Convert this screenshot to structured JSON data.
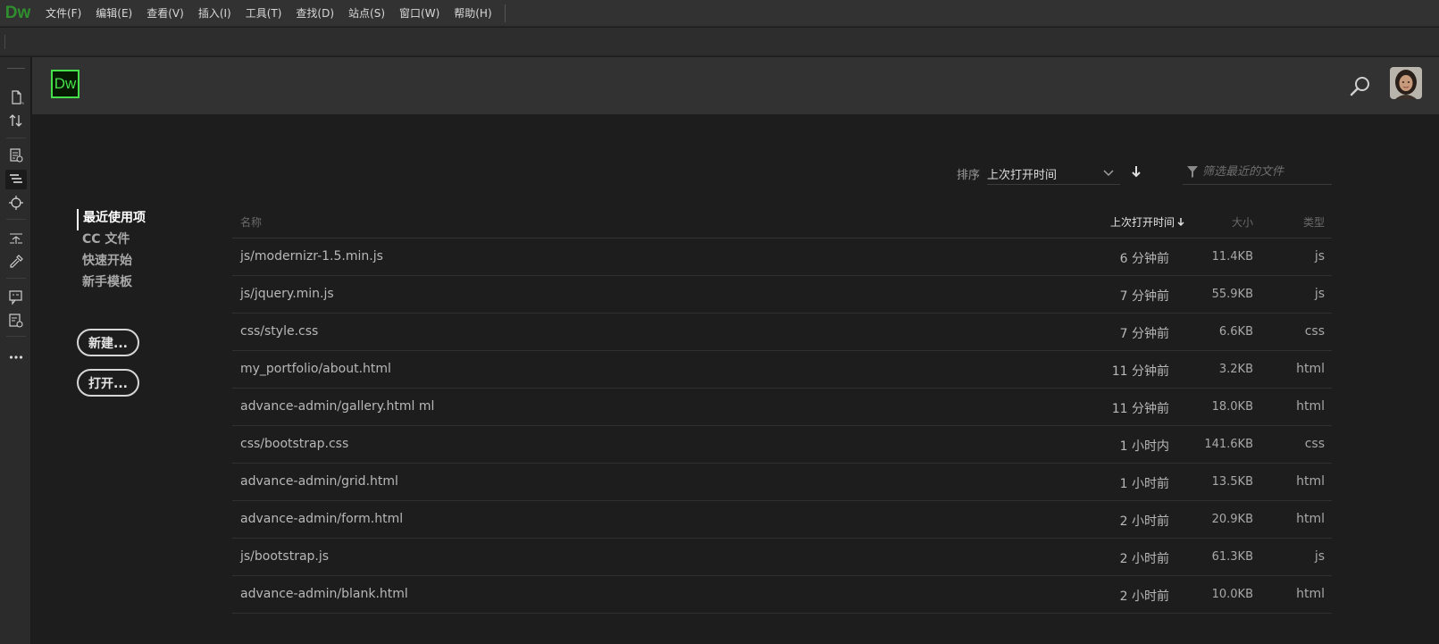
{
  "app": {
    "logo_text": "Dw",
    "menu": [
      "文件(F)",
      "编辑(E)",
      "查看(V)",
      "插入(I)",
      "工具(T)",
      "查找(D)",
      "站点(S)",
      "窗口(W)",
      "帮助(H)"
    ]
  },
  "header": {
    "badge_text": "Dw"
  },
  "sort": {
    "label": "排序",
    "value": "上次打开时间"
  },
  "filter": {
    "placeholder": "筛选最近的文件"
  },
  "nav": {
    "items": [
      "最近使用项",
      "CC 文件",
      "快速开始",
      "新手模板"
    ],
    "active": "最近使用项"
  },
  "buttons": {
    "new_label": "新建...",
    "open_label": "打开..."
  },
  "table": {
    "columns": {
      "name": "名称",
      "time": "上次打开时间",
      "size": "大小",
      "type": "类型"
    },
    "rows": [
      {
        "name": "js/modernizr-1.5.min.js",
        "time": "6 分钟前",
        "size": "11.4KB",
        "type": "js"
      },
      {
        "name": "js/jquery.min.js",
        "time": "7 分钟前",
        "size": "55.9KB",
        "type": "js"
      },
      {
        "name": "css/style.css",
        "time": "7 分钟前",
        "size": "6.6KB",
        "type": "css"
      },
      {
        "name": "my_portfolio/about.html",
        "time": "11 分钟前",
        "size": "3.2KB",
        "type": "html"
      },
      {
        "name": "advance-admin/gallery.html ml",
        "time": "11 分钟前",
        "size": "18.0KB",
        "type": "html"
      },
      {
        "name": "css/bootstrap.css",
        "time": "1 小时内",
        "size": "141.6KB",
        "type": "css"
      },
      {
        "name": "advance-admin/grid.html",
        "time": "1 小时前",
        "size": "13.5KB",
        "type": "html"
      },
      {
        "name": "advance-admin/form.html",
        "time": "2 小时前",
        "size": "20.9KB",
        "type": "html"
      },
      {
        "name": "js/bootstrap.js",
        "time": "2 小时前",
        "size": "61.3KB",
        "type": "js"
      },
      {
        "name": "advance-admin/blank.html",
        "time": "2 小时前",
        "size": "10.0KB",
        "type": "html"
      }
    ]
  },
  "colors": {
    "accent_green": "#46e04a",
    "logo_green": "#2f8f2f",
    "background": "#1d1d1d"
  },
  "icons": {
    "header_search": "search-icon",
    "sort_direction": "arrow-down-icon",
    "filter": "filter-icon"
  }
}
